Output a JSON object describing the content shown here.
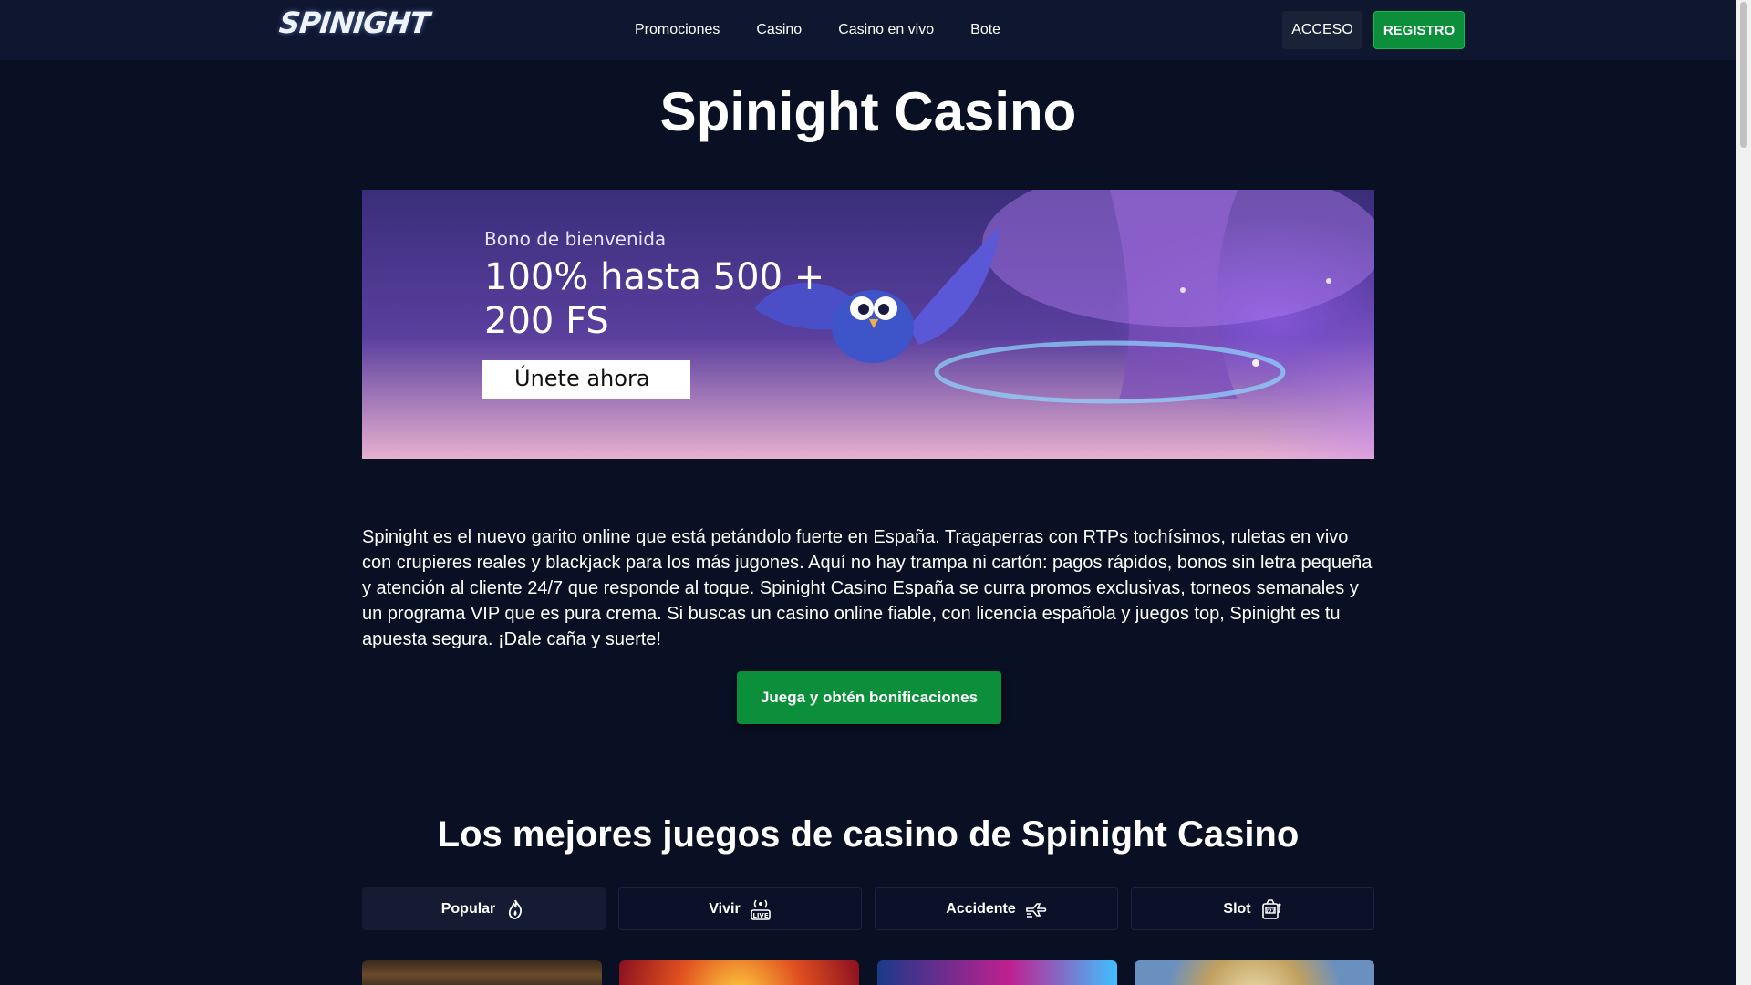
{
  "header": {
    "logo": "SPINIGHT",
    "nav": [
      "Promociones",
      "Casino",
      "Casino en vivo",
      "Bote"
    ],
    "login_label": "ACCESO",
    "register_label": "REGISTRO"
  },
  "page_title": "Spinight Casino",
  "banner": {
    "subtitle": "Bono de bienvenida",
    "headline": "100% hasta 500 + 200 FS",
    "cta_label": "Únete ahora"
  },
  "intro_text": "Spinight es el nuevo garito online que está petándolo fuerte en España. Tragaperras con RTPs tochísimos, ruletas en vivo con crupieres reales y blackjack para los más jugones. Aquí no hay trampa ni cartón: pagos rápidos, bonos sin letra pequeña y atención al cliente 24/7 que responde al toque. Spinight Casino España se curra promos exclusivas, torneos semanales y un programa VIP que es pura crema. Si buscas un casino online fiable, con licencia española y juegos top, Spinight es tu apuesta segura. ¡Dale caña y suerte!",
  "main_cta_label": "Juega y obtén bonificaciones",
  "section_title": "Los mejores juegos de casino de Spinight Casino",
  "tabs": [
    {
      "label": "Popular",
      "icon": "fire-icon"
    },
    {
      "label": "Vivir",
      "icon": "live-icon"
    },
    {
      "label": "Accidente",
      "icon": "plane-icon"
    },
    {
      "label": "Slot",
      "icon": "slot-machine-icon"
    }
  ],
  "colors": {
    "background": "#0a1024",
    "header": "#0e1630",
    "accent_green": "#0b8f3a"
  }
}
